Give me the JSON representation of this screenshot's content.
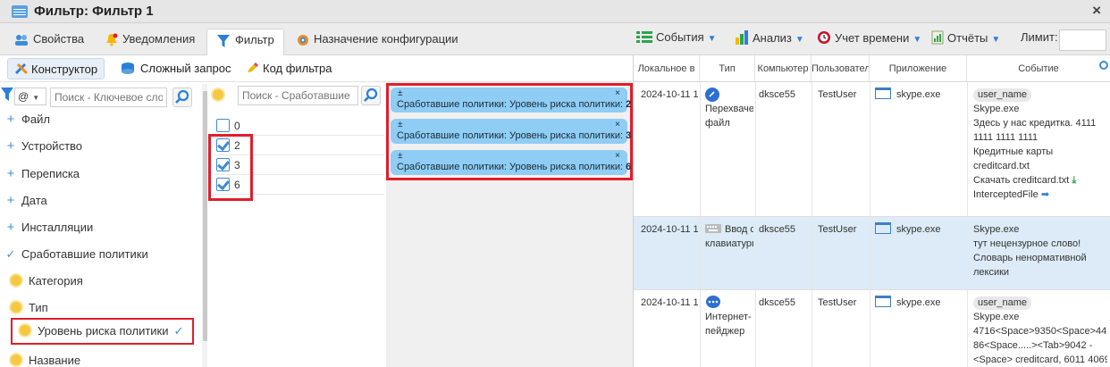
{
  "window": {
    "title": "Фильтр: Фильтр 1",
    "close_glyph": "×"
  },
  "tabs": [
    {
      "label": "Свойства",
      "icon": "people-icon"
    },
    {
      "label": "Уведомления",
      "icon": "bell-icon"
    },
    {
      "label": "Фильтр",
      "icon": "funnel-icon",
      "active": true
    },
    {
      "label": "Назначение конфигурации",
      "icon": "gear-icon"
    }
  ],
  "toolbar": {
    "events": "События",
    "analysis": "Анализ",
    "time_tracking": "Учет времени",
    "reports": "Отчёты",
    "limit_label": "Лимит:",
    "limit_value": ""
  },
  "subtabs": [
    {
      "label": "Конструктор",
      "active": true
    },
    {
      "label": "Сложный запрос"
    },
    {
      "label": "Код фильтра"
    }
  ],
  "left_search": {
    "prefix": "@",
    "placeholder": "Поиск - Ключевое сло"
  },
  "tree": [
    {
      "label": "Файл",
      "toggle": "+"
    },
    {
      "label": "Устройство",
      "toggle": "+"
    },
    {
      "label": "Переписка",
      "toggle": "+"
    },
    {
      "label": "Дата",
      "toggle": "+"
    },
    {
      "label": "Инсталляции",
      "toggle": "+"
    },
    {
      "label": "Сработавшие политики",
      "toggle": "✓"
    },
    {
      "label": "Категория"
    },
    {
      "label": "Тип"
    },
    {
      "label": "Уровень риска политики",
      "selected": true,
      "check": "✓"
    },
    {
      "label": "Название"
    }
  ],
  "mid_search": {
    "placeholder": "Поиск - Сработавшие"
  },
  "values": [
    {
      "label": "0",
      "checked": false
    },
    {
      "label": "2",
      "checked": true
    },
    {
      "label": "3",
      "checked": true
    },
    {
      "label": "6",
      "checked": true
    }
  ],
  "chips": [
    {
      "prefix": "Сработавшие политики: Уровень риска политики:",
      "value": "2",
      "pm": "±",
      "x": "×"
    },
    {
      "prefix": "Сработавшие политики: Уровень риска политики:",
      "value": "3",
      "pm": "±",
      "x": "×"
    },
    {
      "prefix": "Сработавшие политики: Уровень риска политики:",
      "value": "6",
      "pm": "±",
      "x": "×"
    }
  ],
  "grid": {
    "headers": [
      "Локальное в",
      "Тип",
      "Компьютер",
      "Пользовател",
      "Приложение",
      "Событие"
    ],
    "rows": [
      {
        "date": "2024-10-11 1",
        "type_lines": [
          "Перехвачен",
          "файл"
        ],
        "type_icon": "paperclip-icon",
        "computer": "dksce55",
        "user": "TestUser",
        "app": "skype.exe",
        "event_pill": "user_name",
        "event_lines": [
          "Skype.exe",
          "Здесь у нас кредитка. 4111",
          "1111 1111 1111",
          "Кредитные карты",
          "creditcard.txt",
          "Скачать creditcard.txt",
          "InterceptedFile"
        ]
      },
      {
        "date": "2024-10-11 1",
        "type_lines": [
          "Ввод с",
          "клавиатуры"
        ],
        "type_icon": "keyboard-icon",
        "computer": "dksce55",
        "user": "TestUser",
        "app": "skype.exe",
        "event_pill": "",
        "event_lines": [
          "Skype.exe",
          "тут нецензурное слово!",
          "Словарь ненормативной",
          "лексики"
        ]
      },
      {
        "date": "2024-10-11 1",
        "type_lines": [
          "Интернет-",
          "пейджер"
        ],
        "type_icon": "chat-icon",
        "computer": "dksce55",
        "user": "TestUser",
        "app": "skype.exe",
        "event_pill": "user_name",
        "event_lines": [
          "Skype.exe",
          "4716<Space>9350<Space>44",
          "86<Space.....><Tab>9042 -",
          "<Space> creditcard, 6011 4069"
        ]
      }
    ]
  }
}
